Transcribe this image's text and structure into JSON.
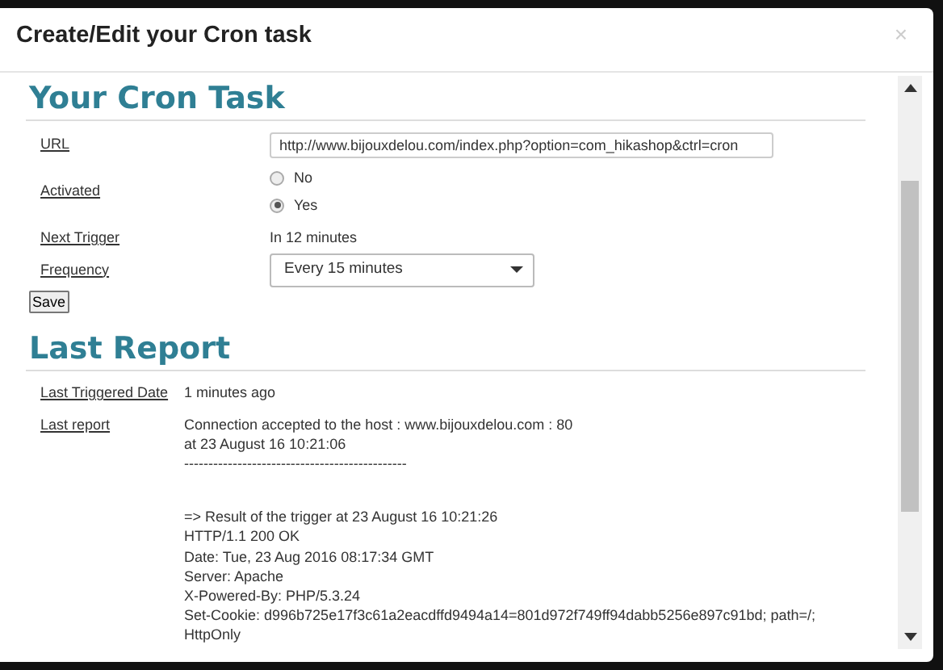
{
  "dialog": {
    "title": "Create/Edit your Cron task",
    "close": "×"
  },
  "cron_task": {
    "heading": "Your Cron Task",
    "url": {
      "label": "URL",
      "value": "http://www.bijouxdelou.com/index.php?option=com_hikashop&ctrl=cron"
    },
    "activated": {
      "label": "Activated",
      "options": [
        {
          "label": "No",
          "selected": false
        },
        {
          "label": "Yes",
          "selected": true
        }
      ]
    },
    "next_trigger": {
      "label": "Next Trigger",
      "value": "In 12 minutes"
    },
    "frequency": {
      "label": "Frequency",
      "value": "Every 15 minutes"
    },
    "save_button": "Save"
  },
  "last_report": {
    "heading": "Last Report",
    "last_triggered_date": {
      "label": "Last Triggered Date",
      "value": "1 minutes ago"
    },
    "report": {
      "label": "Last report",
      "paragraphs": [
        [
          "Connection accepted to the host : www.bijouxdelou.com : 80",
          "at 23 August 16 10:21:06",
          "----------------------------------------------"
        ],
        [
          "=> Result of the trigger at 23 August 16 10:21:26",
          "HTTP/1.1 200 OK",
          "Date: Tue, 23 Aug 2016 08:17:34 GMT",
          "Server: Apache",
          "X-Powered-By: PHP/5.3.24",
          "Set-Cookie: d996b725e17f3c61a2eacdffd9494a14=801d972f749ff94dabb5256e897c91bd; path=/;",
          "HttpOnly"
        ]
      ]
    }
  }
}
